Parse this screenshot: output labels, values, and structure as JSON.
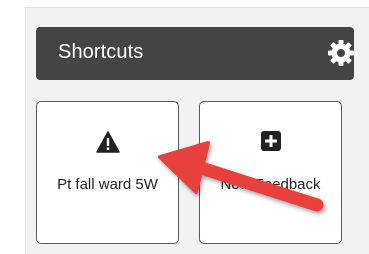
{
  "header": {
    "title": "Shortcuts",
    "settings_icon": "gear-icon"
  },
  "tiles": [
    {
      "label": "Pt fall ward 5W",
      "icon": "warning-icon"
    },
    {
      "label": "New Feedback",
      "icon": "plus-square-icon"
    }
  ],
  "colors": {
    "header_bg": "#444444",
    "header_text": "#ffffff",
    "arrow": "#e8403c",
    "panel_bg": "#f2f2f2"
  }
}
